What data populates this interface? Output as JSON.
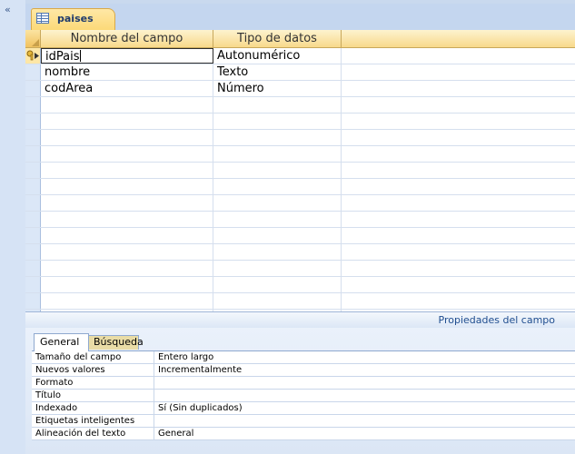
{
  "nav": {
    "collapse_glyph": "«"
  },
  "tab": {
    "label": "paises",
    "icon": "table-icon"
  },
  "grid": {
    "columns": [
      "Nombre del campo",
      "Tipo de datos",
      ""
    ],
    "rows": [
      {
        "name": "idPais",
        "type": "Autonumérico",
        "primary_key": true,
        "current": true
      },
      {
        "name": "nombre",
        "type": "Texto"
      },
      {
        "name": "codArea",
        "type": "Número"
      }
    ],
    "empty_rows": 14
  },
  "properties": {
    "section_label": "Propiedades del campo",
    "tabs": [
      "General",
      "Búsqueda"
    ],
    "items": [
      {
        "label": "Tamaño del campo",
        "value": "Entero largo"
      },
      {
        "label": "Nuevos valores",
        "value": "Incrementalmente"
      },
      {
        "label": "Formato",
        "value": ""
      },
      {
        "label": "Título",
        "value": ""
      },
      {
        "label": "Indexado",
        "value": "Sí (Sin duplicados)"
      },
      {
        "label": "Etiquetas inteligentes",
        "value": ""
      },
      {
        "label": "Alineación del texto",
        "value": "General"
      }
    ]
  },
  "colors": {
    "header_bg": "#f8d98b",
    "tab_bg": "#fcd978",
    "nav_bg": "#d6e3f5",
    "accent_text": "#1f4d8f"
  }
}
